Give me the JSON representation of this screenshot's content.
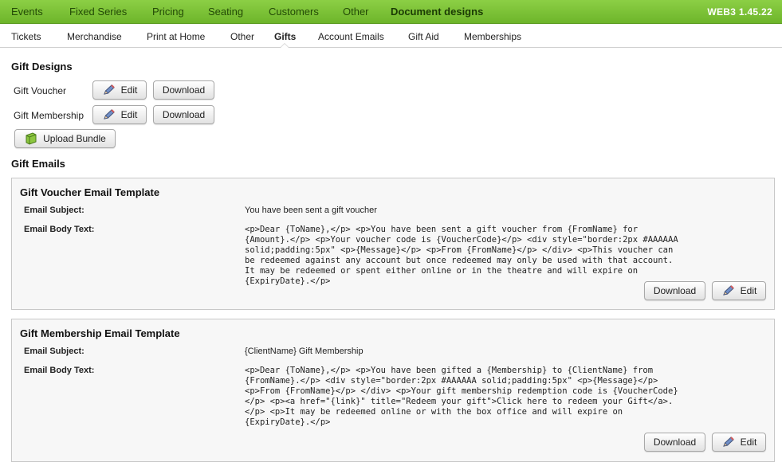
{
  "top_nav": {
    "tabs": [
      {
        "label": "Events"
      },
      {
        "label": "Fixed Series"
      },
      {
        "label": "Pricing"
      },
      {
        "label": "Seating"
      },
      {
        "label": "Customers"
      },
      {
        "label": "Other"
      },
      {
        "label": "Document designs",
        "active": true
      }
    ],
    "version": "WEB3 1.45.22"
  },
  "sub_nav": {
    "tabs": [
      {
        "label": "Tickets"
      },
      {
        "label": "Merchandise"
      },
      {
        "label": "Print at Home"
      },
      {
        "label": "Other"
      },
      {
        "label": "Gifts",
        "active": true
      },
      {
        "label": "Account Emails"
      },
      {
        "label": "Gift Aid"
      },
      {
        "label": "Memberships"
      }
    ]
  },
  "gift_designs": {
    "heading": "Gift Designs",
    "rows": [
      {
        "label": "Gift Voucher",
        "edit_label": "Edit",
        "download_label": "Download"
      },
      {
        "label": "Gift Membership",
        "edit_label": "Edit",
        "download_label": "Download"
      }
    ],
    "upload_label": "Upload Bundle"
  },
  "gift_emails": {
    "heading": "Gift Emails",
    "templates": [
      {
        "title": "Gift Voucher Email Template",
        "subject_label": "Email Subject:",
        "subject": "You have been sent a gift voucher",
        "body_label": "Email Body Text:",
        "body": "<p>Dear {ToName},</p> <p>You have been sent a gift voucher from {FromName} for {Amount}.</p> <p>Your voucher code is {VoucherCode}</p> <div style=\"border:2px #AAAAAA solid;padding:5px\" <p>{Message}</p> <p>From {FromName}</p> </div> <p>This voucher can be redeemed against any account but once redeemed may only be used with that account. It may be redeemed or spent either online or in the theatre and will expire on {ExpiryDate}.</p>",
        "download_label": "Download",
        "edit_label": "Edit"
      },
      {
        "title": "Gift Membership Email Template",
        "subject_label": "Email Subject:",
        "subject": "{ClientName} Gift Membership",
        "body_label": "Email Body Text:",
        "body": "<p>Dear {ToName},</p> <p>You have been gifted a {Membership} to {ClientName} from {FromName}.</p> <div style=\"border:2px #AAAAAA solid;padding:5px\" <p>{Message}</p> <p>From {FromName}</p> </div> <p>Your gift membership redemption code is {VoucherCode}</p> <p><a href=\"{link}\" title=\"Redeem your gift\">Click here to redeem your Gift</a>.</p> <p>It may be redeemed online or with the box office and will expire on {ExpiryDate}.</p>",
        "download_label": "Download",
        "edit_label": "Edit"
      }
    ]
  },
  "colors": {
    "nav_green": "#7cc338",
    "version_text": "#ffffff",
    "panel_bg": "#f7f7f7"
  }
}
